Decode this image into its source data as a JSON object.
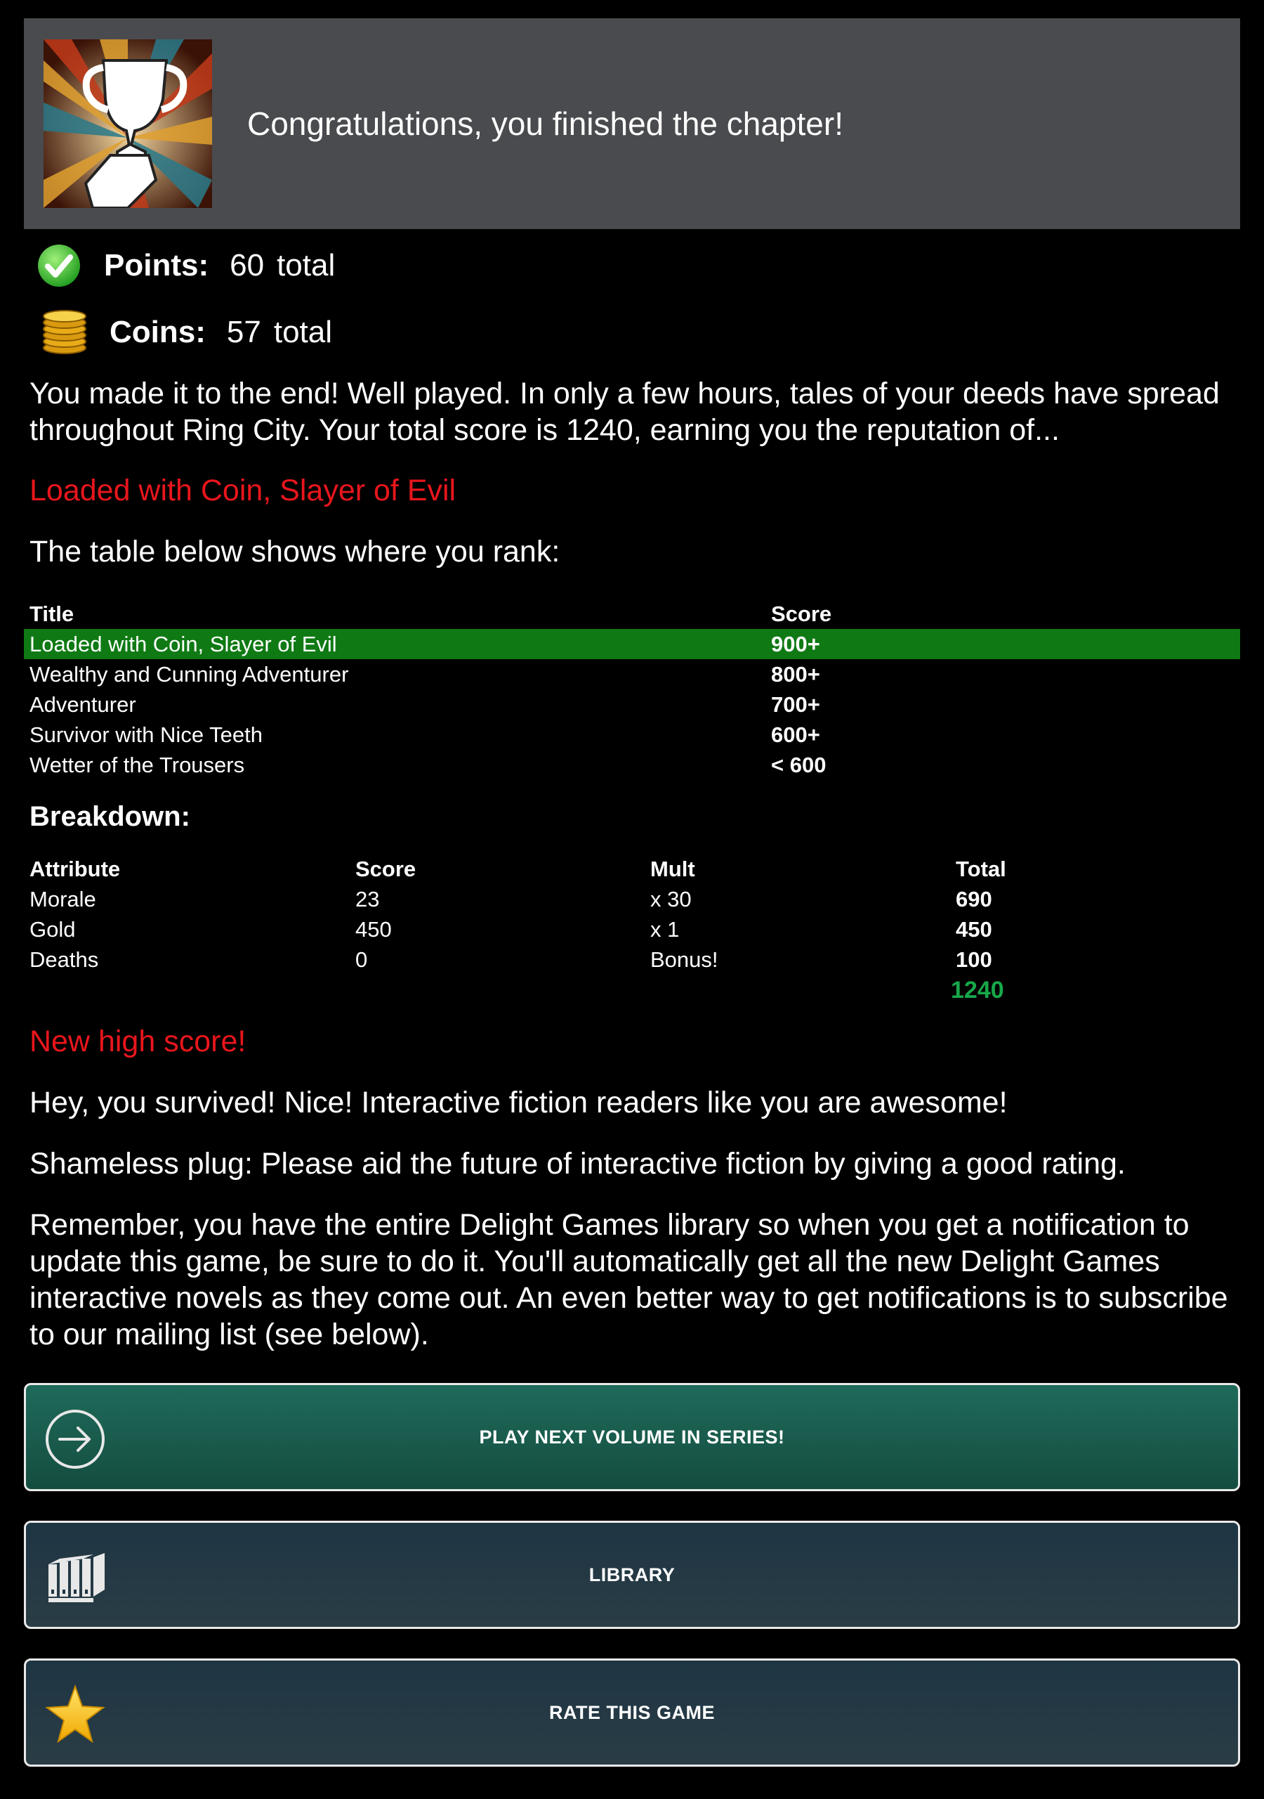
{
  "header": {
    "title": "Congratulations, you finished the chapter!"
  },
  "stats": {
    "points": {
      "label": "Points:",
      "value": "60",
      "suffix": "total"
    },
    "coins": {
      "label": "Coins:",
      "value": "57",
      "suffix": "total"
    }
  },
  "intro": "You made it to the end! Well played. In only a few hours, tales of your deeds have spread throughout Ring City. Your total score is 1240, earning you the reputation of...",
  "reputation": "Loaded with Coin, Slayer of Evil",
  "rank_intro": "The table below shows where you rank:",
  "rank_table": {
    "headers": {
      "title": "Title",
      "score": "Score"
    },
    "rows": [
      {
        "title": "Loaded with Coin, Slayer of Evil",
        "score": "900+"
      },
      {
        "title": "Wealthy and Cunning Adventurer",
        "score": "800+"
      },
      {
        "title": "Adventurer",
        "score": "700+"
      },
      {
        "title": "Survivor with Nice Teeth",
        "score": "600+"
      },
      {
        "title": "Wetter of the Trousers",
        "score": "< 600"
      }
    ],
    "highlighted_row": 0,
    "highlight_color": "#0f7a14"
  },
  "breakdown": {
    "title": "Breakdown:",
    "headers": {
      "attribute": "Attribute",
      "score": "Score",
      "mult": "Mult",
      "total": "Total"
    },
    "rows": [
      {
        "attribute": "Morale",
        "score": "23",
        "mult": "x 30",
        "total": "690"
      },
      {
        "attribute": "Gold",
        "score": "450",
        "mult": "x 1",
        "total": "450"
      },
      {
        "attribute": "Deaths",
        "score": "0",
        "mult": "Bonus!",
        "total": "100"
      }
    ],
    "grand_total": "1240"
  },
  "high_score": "New high score!",
  "para_survived": "Hey, you survived! Nice! Interactive fiction readers like you are awesome!",
  "para_plug": "Shameless plug: Please aid the future of interactive fiction by giving a good rating.",
  "para_remember": "Remember, you have the entire Delight Games library so when you get a notification to update this game, be sure to do it. You'll automatically get all the new Delight Games interactive novels as they come out. An even better way to get notifications is to subscribe to our mailing list (see below).",
  "buttons": {
    "next": {
      "label": "PLAY NEXT VOLUME IN SERIES!",
      "icon": "arrow-circle-right-icon"
    },
    "library": {
      "label": "LIBRARY",
      "icon": "books-icon"
    },
    "rate": {
      "label": "RATE THIS GAME",
      "icon": "star-icon"
    }
  },
  "colors": {
    "accent_red": "#e8161c",
    "total_green": "#18a84a",
    "header_bg": "#4a4b4f"
  }
}
